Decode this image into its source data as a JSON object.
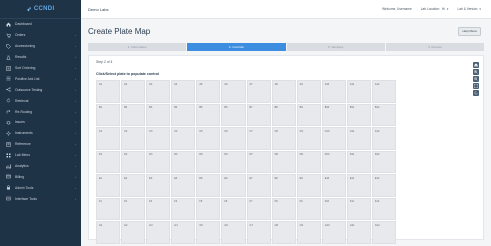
{
  "app": {
    "logo": "CCNDI",
    "name": "Demo Labs"
  },
  "header": {
    "welcome": "Welcome, Username",
    "lab_location_label": "Lab Location:",
    "lab_location_value": "Hi",
    "user_version": "Lab & Version"
  },
  "sidebar": {
    "items": [
      {
        "label": "Dashboard",
        "icon": "home-icon",
        "chevron": false
      },
      {
        "label": "Orders",
        "icon": "cart-icon",
        "chevron": true
      },
      {
        "label": "Accessioning",
        "icon": "tag-icon",
        "chevron": true
      },
      {
        "label": "Results",
        "icon": "flask-icon",
        "chevron": true
      },
      {
        "label": "Sort Ordering",
        "icon": "sort-icon",
        "chevron": true
      },
      {
        "label": "Positive Ack List",
        "icon": "list-icon",
        "chevron": true
      },
      {
        "label": "Outsource Testing",
        "icon": "share-icon",
        "chevron": true
      },
      {
        "label": "Retrieval",
        "icon": "refresh-icon",
        "chevron": true
      },
      {
        "label": "Re-Routing",
        "icon": "route-icon",
        "chevron": true
      },
      {
        "label": "Issues",
        "icon": "bug-icon",
        "chevron": true
      },
      {
        "label": "Instruments",
        "icon": "gear-icon",
        "chevron": true
      },
      {
        "label": "Reference",
        "icon": "book-icon",
        "chevron": true
      },
      {
        "label": "Lab Menu",
        "icon": "menu-icon",
        "chevron": true
      },
      {
        "label": "Analytics",
        "icon": "chart-icon",
        "chevron": true
      },
      {
        "label": "Billing",
        "icon": "card-icon",
        "chevron": true
      },
      {
        "label": "Admin Tools",
        "icon": "lock-icon",
        "chevron": true
      },
      {
        "label": "Interface Tools",
        "icon": "plug-icon",
        "chevron": true
      }
    ]
  },
  "page": {
    "title": "Create Plate Map",
    "help_label": "Help Menu",
    "step_count": "Step 2 of 4",
    "instruction": "Click/Select plate to populate control"
  },
  "steps": [
    {
      "label": "1. Information",
      "active": false
    },
    {
      "label": "2. Controls",
      "active": true
    },
    {
      "label": "3. Samples",
      "active": false
    },
    {
      "label": "4. Review",
      "active": false
    }
  ],
  "plate": {
    "rows": [
      [
        "A1",
        "A2",
        "A3",
        "A4",
        "A5",
        "A6",
        "A7",
        "A8",
        "A9",
        "A10",
        "A11",
        "A12"
      ],
      [
        "B1",
        "B2",
        "B3",
        "B4",
        "B5",
        "B6",
        "B7",
        "B8",
        "B9",
        "B10",
        "B11",
        "B12"
      ],
      [
        "C1",
        "C2",
        "C3",
        "C4",
        "C5",
        "C6",
        "C7",
        "C8",
        "C9",
        "C10",
        "C11",
        "C12"
      ],
      [
        "D1",
        "D2",
        "D3",
        "D4",
        "D5",
        "D6",
        "D7",
        "D8",
        "D9",
        "D10",
        "D11",
        "D12"
      ],
      [
        "E1",
        "E2",
        "E3",
        "E4",
        "E5",
        "E6",
        "E7",
        "E8",
        "E9",
        "E10",
        "E11",
        "E12"
      ],
      [
        "F1",
        "F2",
        "F3",
        "F4",
        "F5",
        "F6",
        "F7",
        "F8",
        "F9",
        "F10",
        "F11",
        "F12"
      ],
      [
        "G1",
        "G2",
        "G3",
        "G4",
        "G5",
        "G6",
        "G7",
        "G8",
        "G9",
        "G10",
        "G11",
        "G12"
      ]
    ]
  },
  "tools": [
    "home-icon",
    "zoom-in-icon",
    "zoom-out-icon",
    "fullscreen-icon",
    "reset-icon"
  ]
}
